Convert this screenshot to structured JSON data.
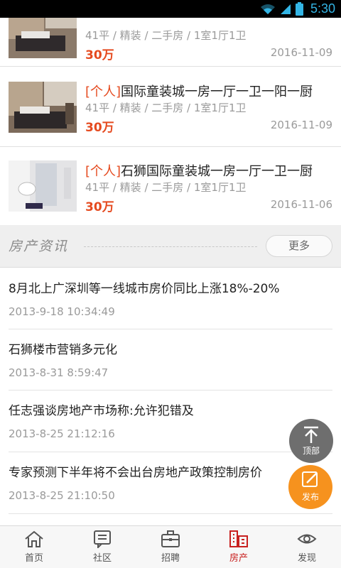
{
  "status_bar": {
    "time": "5:30",
    "icons": [
      "wifi-icon",
      "signal-icon",
      "battery-icon"
    ]
  },
  "listings": [
    {
      "tag": "",
      "title": "",
      "meta": "41平 / 精装 / 二手房 / 1室1厅1卫",
      "price": "30万",
      "date": "2016-11-09"
    },
    {
      "tag": "[个人]",
      "title": "国际童装城一房一厅一卫一阳一厨",
      "meta": "41平 / 精装 / 二手房 / 1室1厅1卫",
      "price": "30万",
      "date": "2016-11-09"
    },
    {
      "tag": "[个人]",
      "title": "石狮国际童装城一房一厅一卫一厨",
      "meta": "41平 / 精装 / 二手房 / 1室1厅1卫",
      "price": "30万",
      "date": "2016-11-06"
    }
  ],
  "news_section": {
    "title": "房产资讯",
    "more_label": "更多"
  },
  "news": [
    {
      "title": "8月北上广深圳等一线城市房价同比上涨18%-20%",
      "date": "2013-9-18 10:34:49"
    },
    {
      "title": "石狮楼市营销多元化",
      "date": "2013-8-31 8:59:47"
    },
    {
      "title": "任志强谈房地产市场称:允许犯错及",
      "date": "2013-8-25 21:12:16"
    },
    {
      "title": "专家预测下半年将不会出台房地产政策控制房价",
      "date": "2013-8-25 21:10:50"
    }
  ],
  "fab": {
    "top_label": "顶部",
    "post_label": "发布"
  },
  "tabs": [
    {
      "label": "首页",
      "icon": "home-icon",
      "active": false
    },
    {
      "label": "社区",
      "icon": "community-icon",
      "active": false
    },
    {
      "label": "招聘",
      "icon": "briefcase-icon",
      "active": false
    },
    {
      "label": "房产",
      "icon": "building-icon",
      "active": true
    },
    {
      "label": "发现",
      "icon": "eye-icon",
      "active": false
    }
  ],
  "colors": {
    "accent": "#e54a1f",
    "active_tab": "#c8201f",
    "status_blue": "#33b5e5",
    "post_fab": "#f6921e",
    "top_fab": "#6e6e6e"
  }
}
